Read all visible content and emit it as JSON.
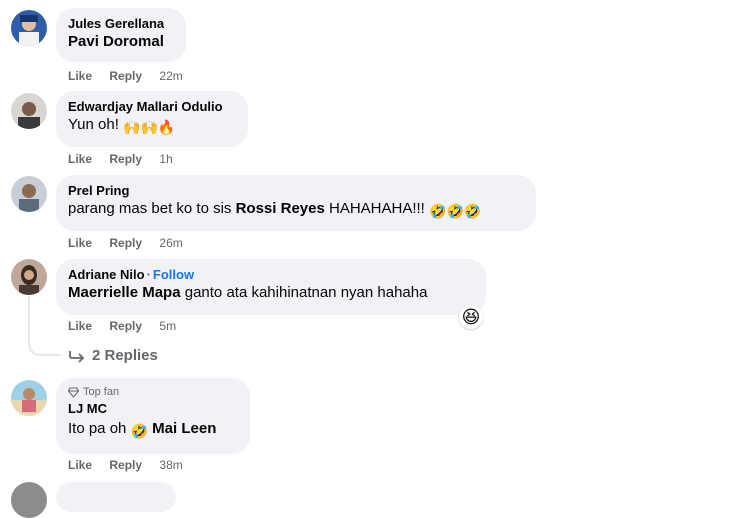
{
  "comments": [
    {
      "author": "Jules Gerellana",
      "text": "Pavi Doromal",
      "text_is_mention": true,
      "like": "Like",
      "reply": "Reply",
      "time": "22m"
    },
    {
      "author": "Edwardjay Mallari Odulio",
      "text": "Yun oh!",
      "emojis": "🙌🙌🔥",
      "like": "Like",
      "reply": "Reply",
      "time": "1h"
    },
    {
      "author": "Prel Pring",
      "text_before": "parang mas bet ko to sis",
      "mention": "Rossi Reyes",
      "text_after": "HAHAHAHA!!!",
      "emojis": "🤣🤣🤣",
      "like": "Like",
      "reply": "Reply",
      "time": "26m"
    },
    {
      "author": "Adriane Nilo",
      "follow": "Follow",
      "mention": "Maerrielle Mapa",
      "text_after": "ganto ata kahihinatnan nyan hahaha",
      "reaction": "😆",
      "like": "Like",
      "reply": "Reply",
      "time": "5m",
      "replies_label": "2 Replies"
    },
    {
      "badge": "Top fan",
      "author": "LJ MC",
      "text_before": "Ito pa oh",
      "emojis": "🤣",
      "mention": "Mai Leen",
      "like": "Like",
      "reply": "Reply",
      "time": "38m"
    }
  ],
  "icons": [
    "avatar",
    "reply-arrow-icon",
    "top-fan-diamond-icon",
    "laughing-emoji-icon"
  ],
  "colors": {
    "bubble": "#f0f2f5",
    "meta": "#65676b",
    "follow": "#1877f2"
  }
}
